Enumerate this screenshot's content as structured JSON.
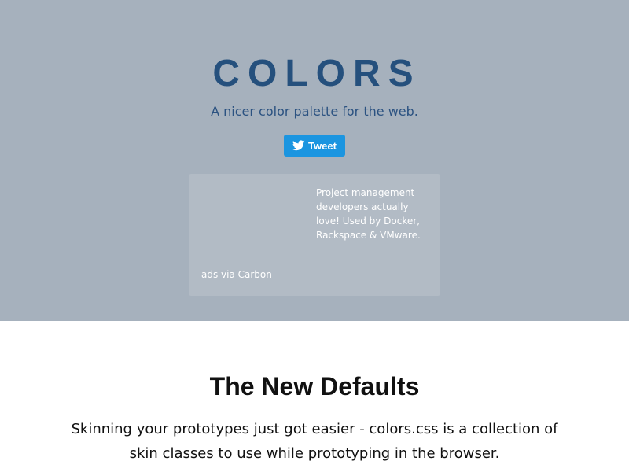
{
  "header": {
    "logo_text": "COLORS",
    "tagline": "A nicer color palette for the web.",
    "tweet_button": {
      "label": "Tweet",
      "icon": "twitter-bird-icon"
    }
  },
  "ad": {
    "text": "Project management developers actually love! Used by Docker, Rackspace & VMware.",
    "via": "ads via Carbon"
  },
  "main": {
    "section_title": "The New Defaults",
    "description": "Skinning your prototypes just got easier - colors.css is a collection of skin classes to use while prototyping in the browser."
  },
  "colors": {
    "hero_background": "#a6b1bd",
    "logo": "#25507d",
    "tweet_button": "#1b95e0",
    "ad_background": "#b2bbc5",
    "content_background": "#ffffff",
    "body_text": "#111111"
  }
}
